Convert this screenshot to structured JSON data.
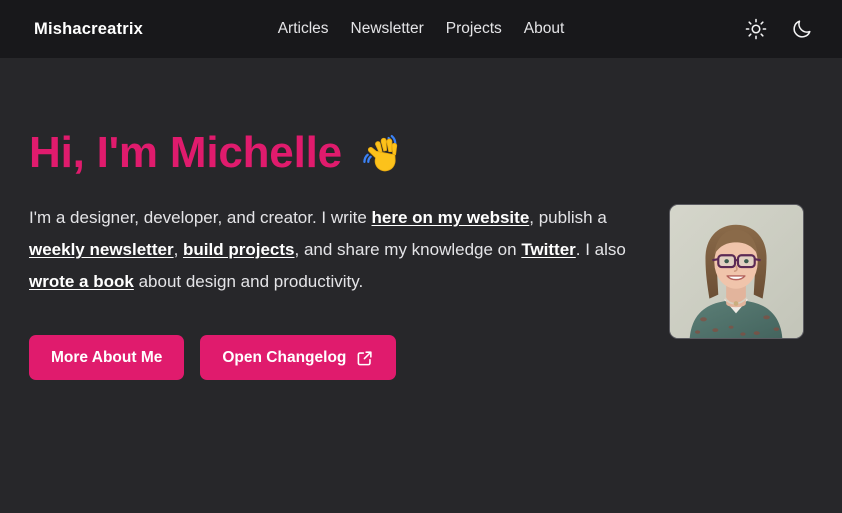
{
  "theme": {
    "accent": "#e01b6d",
    "header_bg": "#18181b",
    "body_bg": "#27272a",
    "text": "#e4e4e7",
    "link": "#ffffff"
  },
  "header": {
    "logo": "Mishacreatrix",
    "nav": [
      {
        "label": "Articles",
        "name": "nav-link-articles"
      },
      {
        "label": "Newsletter",
        "name": "nav-link-newsletter"
      },
      {
        "label": "Projects",
        "name": "nav-link-projects"
      },
      {
        "label": "About",
        "name": "nav-link-about"
      }
    ],
    "toggles": [
      {
        "icon": "sun-icon",
        "name": "light-mode-toggle"
      },
      {
        "icon": "moon-icon",
        "name": "dark-mode-toggle"
      }
    ]
  },
  "hero": {
    "title": "Hi, I'm Michelle",
    "emoji": "waving-hand-emoji",
    "paragraph": {
      "part1": "I'm a designer, developer, and creator. I write ",
      "link1": "here on my website",
      "part2": ", publish a ",
      "link2": "weekly newsletter",
      "part3": ", ",
      "link3": "build projects",
      "part4": ", and share my knowledge on ",
      "link4": "Twitter",
      "part5": ". I also ",
      "link5": "wrote a book",
      "part6": " about design and productivity."
    },
    "avatar_alt": "profile-photo",
    "buttons": [
      {
        "label": "More About Me",
        "name": "more-about-me-button",
        "icon": null
      },
      {
        "label": "Open Changelog",
        "name": "open-changelog-button",
        "icon": "external-link-icon"
      }
    ]
  }
}
